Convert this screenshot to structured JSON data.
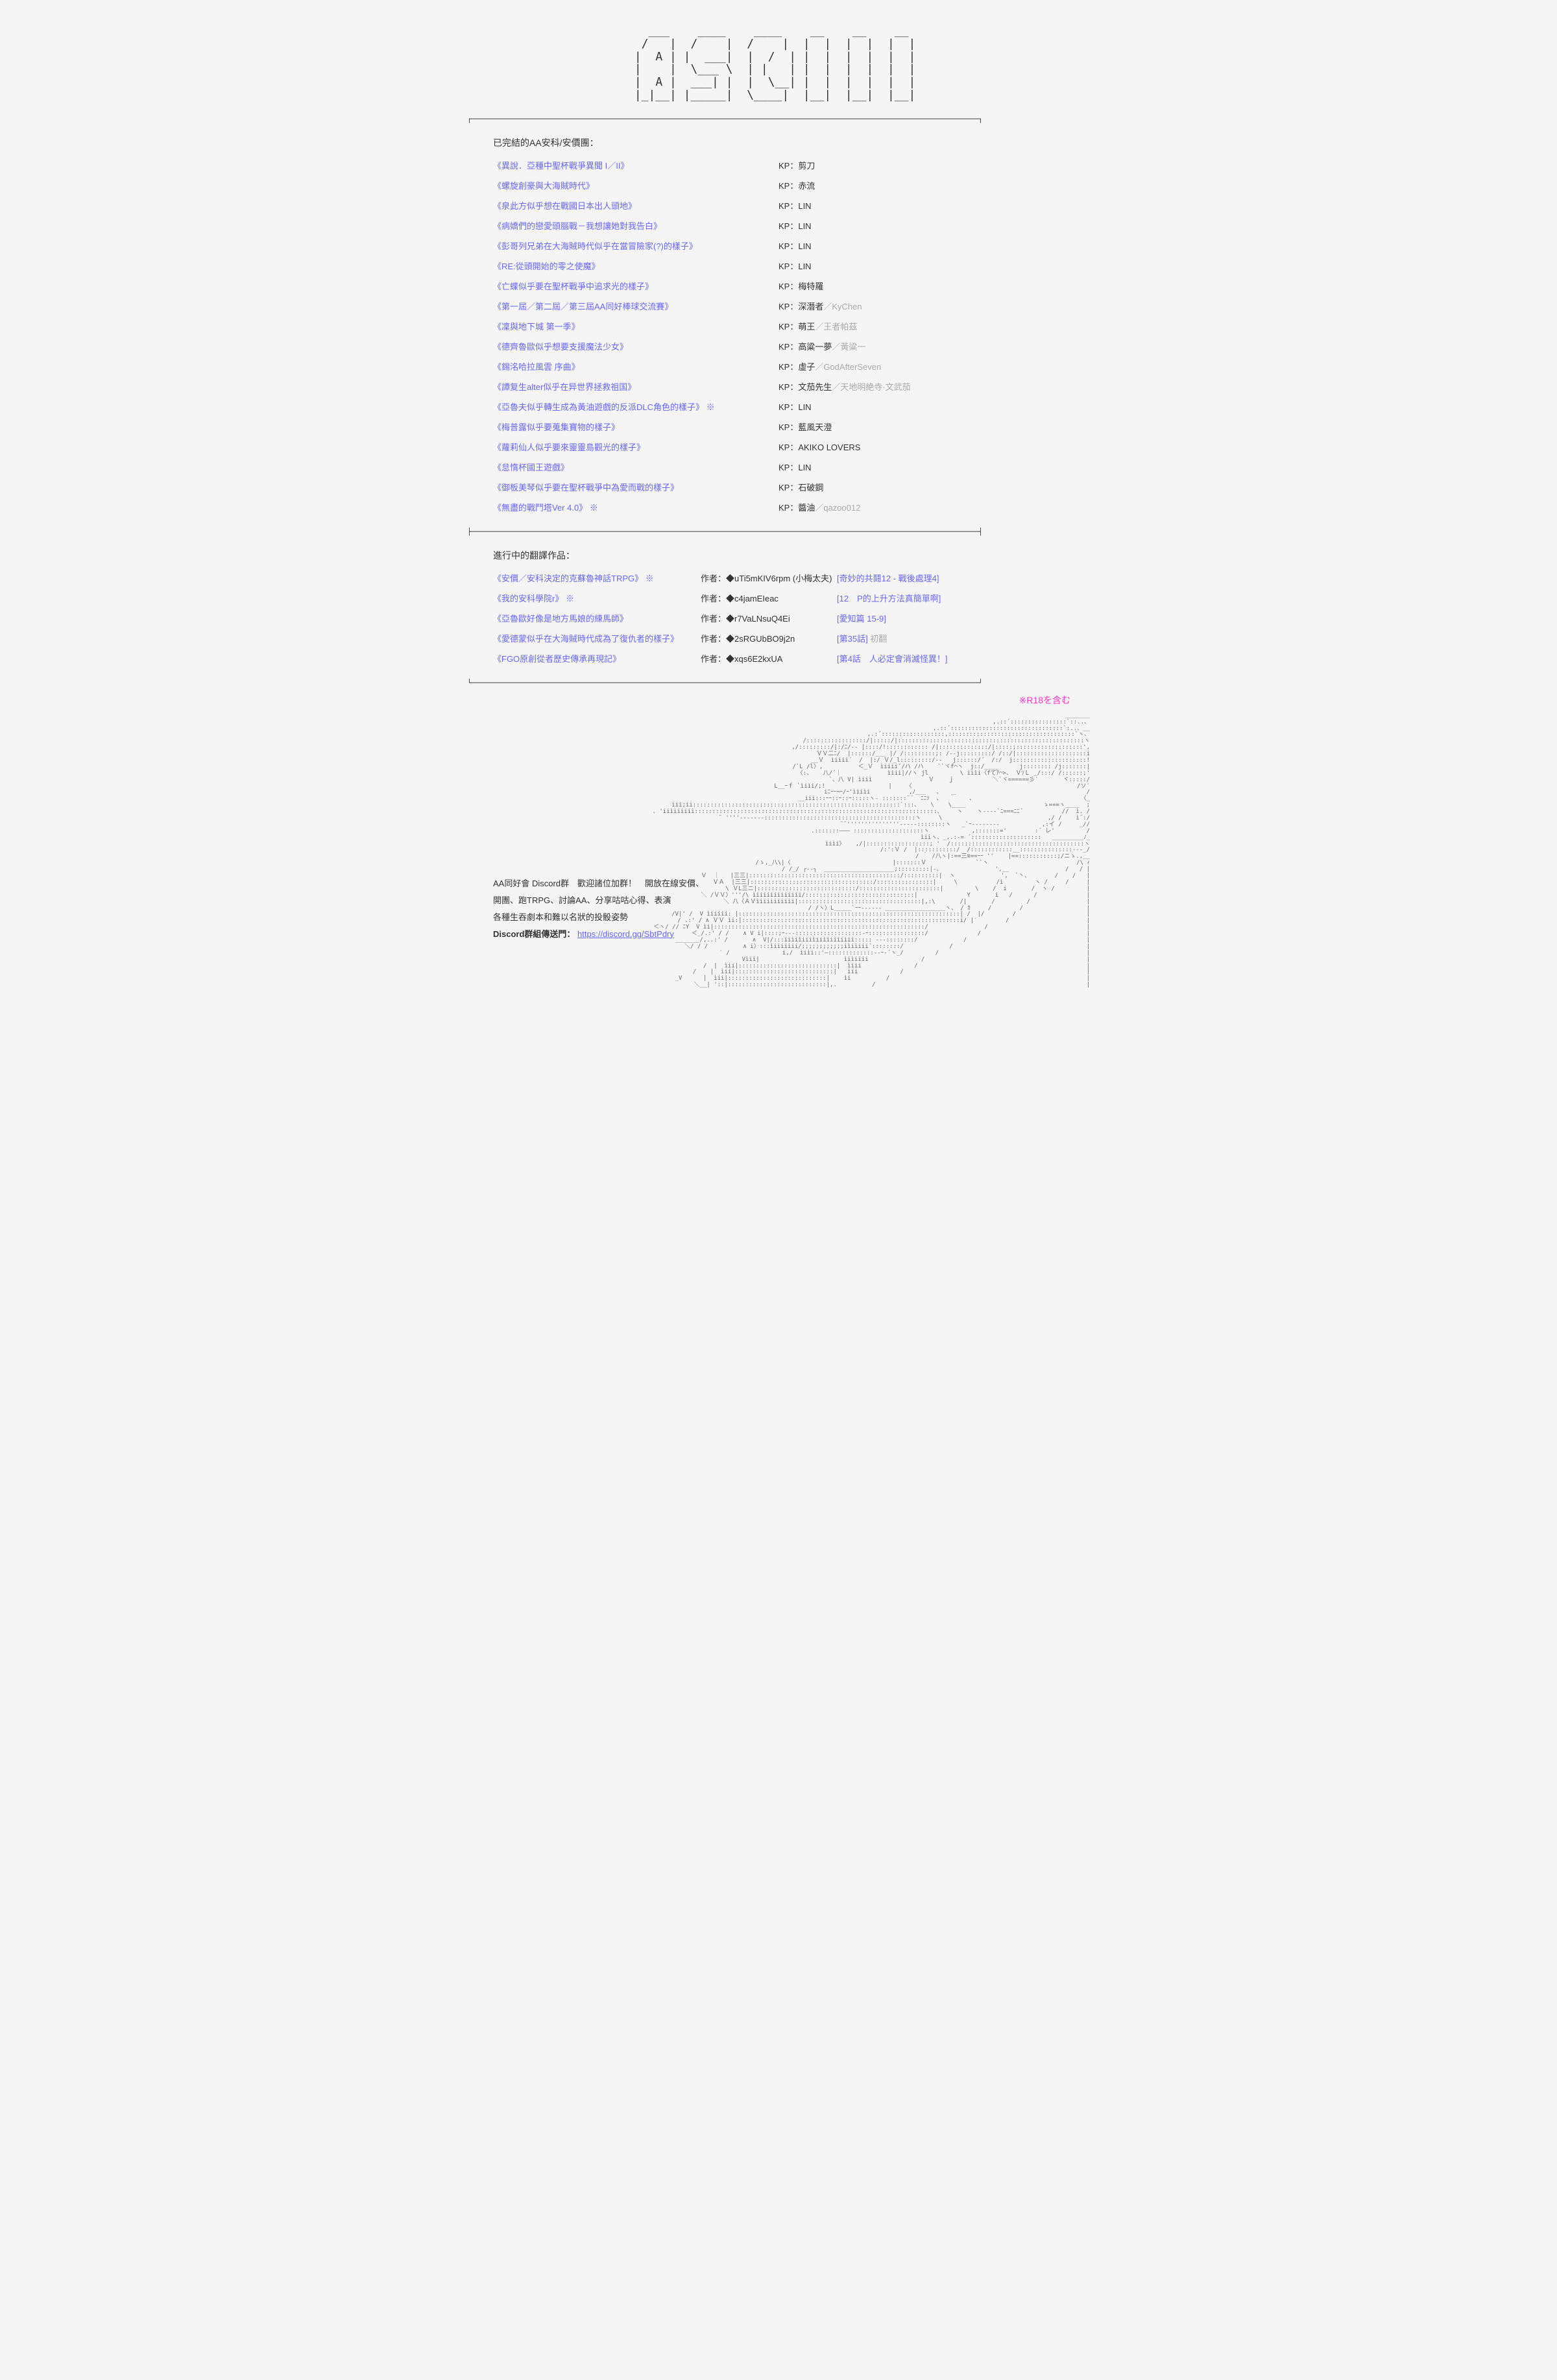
{
  "logo_ascii": "  ____   ____      __    __     __   __  \n /    | /    |   /    | /  |   |  | |  | \n|  A  ||   __|  |  /__ |   |   |  | |  | \n|     | \\___  | |     |/   |   |  | |  | \n|  A  |  __|  |  \\___/ \\___|   |  | |  | \n|__|__||_____|                 |__| |__| ",
  "completed_section_title": "已完結的AA安科/安價團：",
  "completed_works": [
    {
      "title": "《異說．亞種中聖杯戰爭異聞 I／II》",
      "kp": "剪刀"
    },
    {
      "title": "《螺旋創豪與大海賊時代》",
      "kp": "赤流"
    },
    {
      "title": "《泉此方似乎想在戰國日本出人頭地》",
      "kp": "LIN"
    },
    {
      "title": "《病嬌們的戀愛頭腦戰－我想讓她對我告白》",
      "kp": "LIN"
    },
    {
      "title": "《彭哥列兄弟在大海賊時代似乎在當冒險家(?)的樣子》",
      "kp": "LIN"
    },
    {
      "title": "《RE:從頭開始的零之使魔》",
      "kp": "LIN"
    },
    {
      "title": "《亡蝶似乎要在聖杯戰爭中追求光的樣子》",
      "kp": "梅特羅"
    },
    {
      "title": "《第一屆／第二屆／第三屆AA同好棒球交流賽》",
      "kp": "深潛者",
      "alias": "／KyChen"
    },
    {
      "title": "《凜與地下城 第一季》",
      "kp": "萌王",
      "alias": "／王者帕茲"
    },
    {
      "title": "《德齊魯歐似乎想要支援魔法少女》",
      "kp": "高粱一夢",
      "alias": "／黃粱一"
    },
    {
      "title": "《錫洺哈拉風雲 序曲》",
      "kp": "虛子",
      "alias": "／GodAfterSeven"
    },
    {
      "title": "《譚复生alter似乎在异世界拯救祖国》",
      "kp": "文茄先生",
      "alias": "／天地明絶寺·文武茄"
    },
    {
      "title": "《亞魯夫似乎轉生成為黃油遊戲的反派DLC角色的樣子》",
      "mark": "※",
      "kp": "LIN"
    },
    {
      "title": "《梅普露似乎要蒐集寶物的樣子》",
      "kp": "藍風天澄"
    },
    {
      "title": "《蘿莉仙人似乎要來靈靈島觀光的樣子》",
      "kp": "AKIKO LOVERS"
    },
    {
      "title": "《怠惰杯國王遊戲》",
      "kp": "LIN"
    },
    {
      "title": "《御板美琴似乎要在聖杯戰爭中為愛而戰的樣子》",
      "kp": "石破鋼"
    },
    {
      "title": "《無盡的戰鬥塔Ver 4.0》",
      "mark": "※",
      "kp": "醬油",
      "alias": "／qazoo012"
    }
  ],
  "translation_section_title": "進行中的翻譯作品：",
  "translation_works": [
    {
      "title": "《安價／安科決定的克蘇魯神話TRPG》",
      "mark": "※",
      "author": "◆uTi5mKIV6rpm (小梅太夫)",
      "note": "[奇妙的共鬪12 - 戰後處理4]"
    },
    {
      "title": "《我的安科學院r》",
      "mark": "※",
      "author": "◆c4jamEIeac",
      "note": "[12　P的上升方法真簡單啊]"
    },
    {
      "title": "《亞魯歐好像是地方馬娘的練馬師》",
      "author": "◆r7VaLNsuQ4Ei",
      "note": "[愛知篇 15-9]"
    },
    {
      "title": "《愛德蒙似乎在大海賊時代成為了復仇者的樣子》",
      "author": "◆2sRGUbBO9j2n",
      "note": "[第35話]",
      "extra": " 初翻"
    },
    {
      "title": "《FGO原創從者歷史傳承再現記》",
      "author": "◆xqs6E2kxUA",
      "note": "[第4話　人必定會消滅怪異！]"
    }
  ],
  "r18_note": "※R18を含む",
  "discord_text_1": "AA同好會 Discord群　歡迎諸位加群！　開放在線安價、",
  "discord_text_2": "開團、跑TRPG、討論AA、分享咕咕心得、表演",
  "discord_text_3": "各種生吞劇本和難以名狀的投骰姿勢",
  "discord_text_4": "Discord群組傳送門：",
  "discord_link": "https://discord.gg/SbtPdry",
  "kp_label": "KP：",
  "author_label": "作者：",
  "ascii_art": "                                                    _______\n                                               ,.::´::::::::::::::::`::..、\n                                           ,.::´::::::::::::::::::::::::::::::::`:..、__\n                                        ,.:´::::::::::::::::::,::::::::::::::::::::::::::::::::::::`ヽ、\n                                      /:::::::::::::::::/|:::::/|:::::::::::::::::::::::::::::::::::::::::::::::::::::ヽ\n                                    ,/:::::::::/|:/ﾆ/‐- |::::/!:::::::::::: /|::::::::::::::/|:::::;:::::::::::::::::::',\n                                ＶＶ二ﾆ/  |::::::/___ |/ /:::::::::;: /-‐j:::::::::/ /::/|::::::::::::::::::::i\n                             __Ｖ  ìiiii´  /  |:/ Ｖ/_l:::::::::/‐-   j::::::/´  /:/  j:::::::::::::::::::::!\n        /`L /l〉,          ＜_Ｖ  ìiiii´/ハ /ハ    ``ヾf⌒ヽ  j::/____      j:::::::: /j:::::::|\n        〈:、   八/´｜             ìiii|//ヽ jl         \\ iiìi〈fてｱ⌒>、 ＶｿＬ _/:::/ /::::::;'\n         `、八 V| ìiiì                Ｖ    ｊ           ＼`ヾ======彡′       ヾ:::::/\n           L__ｰｆ `ìiìi/;!                  |    〈                                               /ソ′\n            iﾆｰｰ¬ｰ/ｰ'ìiiìi           ,ﾉ___   、   _                                     /\n          __iii:::ｰｰ::ｰ::ｰ:::::ヽ- :::::::¨´  ﾆﾆｿ  、  ｀    、                              〈_\n    ìii;ii:::::::::::::::::::::::::::::::::::::::::::::::::::::::::::`:::、   \\    \\____                      ゝ===ヽ____  ;\n  . 'iiìiiiiii:::::::::::::::::::::::::::::::::::::::::::::::::::::::::::::::::::::、    ヽ    ヽ----`ﾆ===ﾆﾆ´           //  ì. /\n           ¨ ''''‐------:::::::::::::::::::::::::::::::::::::::::::ヽ     \\                              ,/ /    ì´:/\n                                ¨¨'''''''''''''''-----::::::::ヽ   _`ｰ-------‐            ,:イ /     _//\n                                .:::::::――― ::::::::::::::::::::ヽ            ,:::::::='        :´ レ'         /\n                                                           ìiiヽ、_,.:-= ´::::::::::::::::::::   _________ﾉ_\n                                                             ìiìi〉   ,/|::::::::::::::::::; '  /::::::::::::::::::::::::::::::::::::::ヽ\n                                                         /:':Ｖ /  |:::::::::::/  /::::::::::::__:::::::::::::::---_/\n                                                     / ｀ /八ヽ|:==三≡==ｰｰ ''    |==:::::::::::;/ニゝ.,__\n                                                   /ゝ,_八\\|〈                             |:::::::Ｖ              ``ヽ                         /\\ ｨ\n                                                / /_/ ┌‐‐┐  ____________________;:::::::::|-、               ',__                /   / |\n                                              Ｖ  ｜   |三三|:::::::::::::::::::::::::::::::::::::::::::/::::::::::|  ヽ             ',  `丶、       /    /   |\n                                                ＶＡ  |三三|:::::::::::::::::::::::::::::::::::/::::::::::::::::|     \\           /i         ヽ /     /     |\n                                                   \\ ＶL三ニ|::::::::::::::::::::::::::::/:::::::::::::::::::::::|         \\    /  i       /  ヽ /         |\n                                                     ＼ /ＶＶ〉'''/\\ ìiiiiiiiiiiiii/:::::::::::::::::::::::::::::::|              Y       i   /      /              |\n                                                        ＼ 八〈ＡＶìiiiiiiiiii|:::::::::::::::::::::::::::::::::::|,:\\       /|       /         /                |\n                                                        / /ヽ〉L_____`ｰｰ------ _________________ヽ、 / ｶ     /        /                  |\n                                                 /V|' /  V ìiiiii: |:::::::::::::::::::::::::::::::::::::::::::::::::::::::::::::::| /  |/        /                    |\n                                              / .:' / ∧ ＶＶ ìi:|::::::::::::::::::::::::::::::::::::::::::::::::::::::::::::::i/ |′        /                      |\n                                            ＜ヽ/ // ﾆY  V ìi|::::::::::::::::::::::::::::::::::::::::::::::::::::::::::::/                /                            |\n                                          ＜_/.:' / /    ∧ V i|::::;ｰ---:::::::::::::::::::-ｰ::::::::::::::::/              /                              |\n                                        _______/,..:' /       ∧  V|/:::iiìiìiiiìiiìiiiiiiii::::: ---::::::::/             /                                  |\n                                            ＼/ / /          ∧ i〉:::ìiiiiiii/;;;;;;;;;;;;iìiiiii´::::::::/             /                                      |\n                                               ′ /               i,/  ìiìi::'―:::::::::::::--ｰ‐´ヽ_/         /                                          |\n                                                                    Vìii|                        ìiìiiii               /                                              |\n                                                                /  |  ìii|::::::::::::::::::::::::::::|  ìiii               /                                                |\n                                                              /    |  ìii|::::::::::::::::::::::::::::|   ìii            /                                                    |\n                                                           _V      |  ìii|::::::::::::::::::::::::::::|    ìi          /                                                        |\n                                                              ＼__| '::|::::::::::::::::::::::::::::|,.          /                                                            |"
}
